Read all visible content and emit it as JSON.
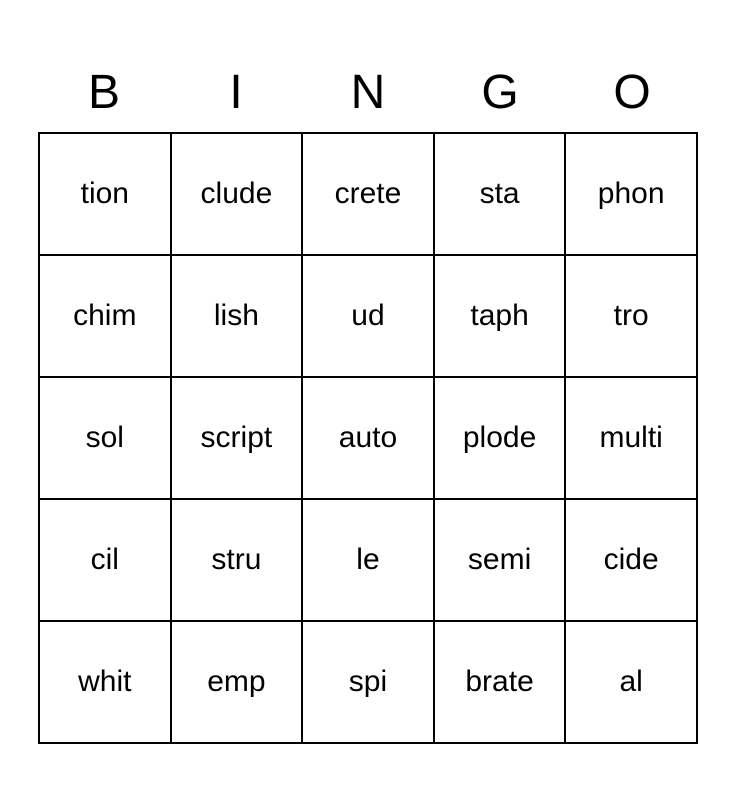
{
  "header": {
    "letters": [
      "B",
      "I",
      "N",
      "G",
      "O"
    ]
  },
  "grid": {
    "rows": [
      [
        "tion",
        "clude",
        "crete",
        "sta",
        "phon"
      ],
      [
        "chim",
        "lish",
        "ud",
        "taph",
        "tro"
      ],
      [
        "sol",
        "script",
        "auto",
        "plode",
        "multi"
      ],
      [
        "cil",
        "stru",
        "le",
        "semi",
        "cide"
      ],
      [
        "whit",
        "emp",
        "spi",
        "brate",
        "al"
      ]
    ]
  }
}
